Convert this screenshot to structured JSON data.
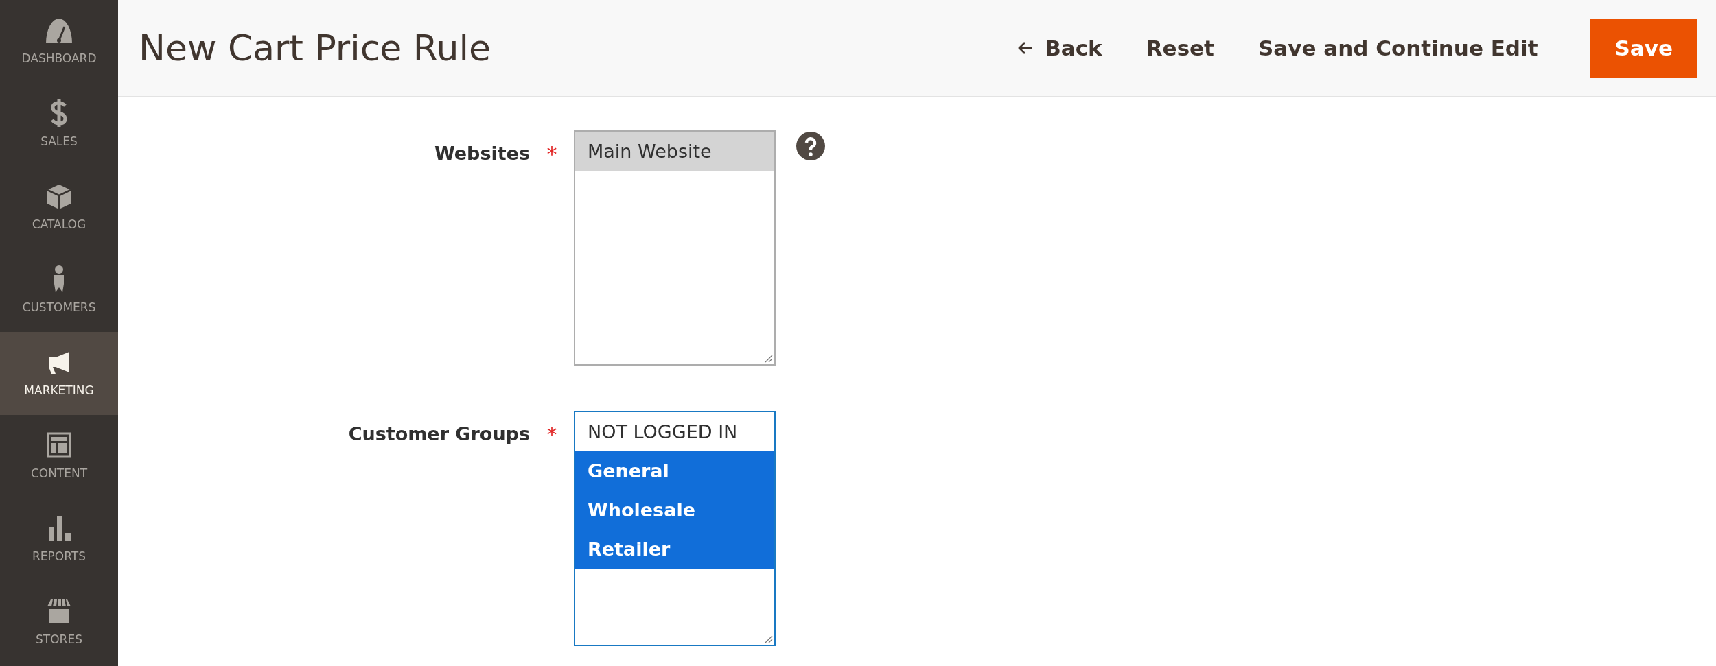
{
  "sidebar": {
    "items": [
      {
        "kind": "dashboard",
        "label": "DASHBOARD",
        "selected": false
      },
      {
        "kind": "sales",
        "label": "SALES",
        "selected": false
      },
      {
        "kind": "catalog",
        "label": "CATALOG",
        "selected": false
      },
      {
        "kind": "customers",
        "label": "CUSTOMERS",
        "selected": false
      },
      {
        "kind": "marketing",
        "label": "MARKETING",
        "selected": true
      },
      {
        "kind": "content",
        "label": "CONTENT",
        "selected": false
      },
      {
        "kind": "reports",
        "label": "REPORTS",
        "selected": false
      },
      {
        "kind": "stores",
        "label": "STORES",
        "selected": false
      }
    ]
  },
  "header": {
    "title": "New Cart Price Rule",
    "actions": [
      {
        "kind": "back",
        "label": "Back"
      },
      {
        "kind": "link",
        "label": "Reset"
      },
      {
        "kind": "link",
        "label": "Save and Continue Edit"
      },
      {
        "kind": "primary",
        "label": "Save"
      }
    ]
  },
  "form": {
    "fields": [
      {
        "label": "Websites",
        "required": "*",
        "focused": false,
        "help": true,
        "options": [
          {
            "label": "Main Website",
            "selected": true
          }
        ]
      },
      {
        "label": "Customer Groups",
        "required": "*",
        "focused": true,
        "help": false,
        "options": [
          {
            "label": "NOT LOGGED IN",
            "selected": false
          },
          {
            "label": "General",
            "selected": true
          },
          {
            "label": "Wholesale",
            "selected": true
          },
          {
            "label": "Retailer",
            "selected": true
          }
        ]
      }
    ]
  }
}
